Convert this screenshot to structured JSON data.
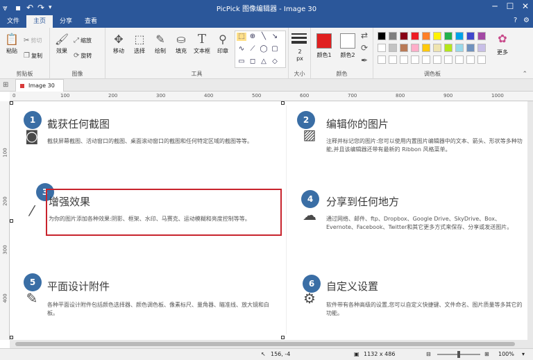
{
  "titlebar": {
    "title": "PicPick 图像编辑器 - Image 30"
  },
  "tabs": [
    "文件",
    "主页",
    "分享",
    "查看"
  ],
  "ribbon": {
    "clipboard": {
      "paste": "粘贴",
      "cut": "剪切",
      "copy": "复制",
      "label": "剪贴板"
    },
    "image": {
      "effects": "效果",
      "resize": "缩放",
      "rotate": "旋转",
      "label": "图像"
    },
    "tools": {
      "move": "移动",
      "select": "选择",
      "draw": "绘制",
      "fill": "填充",
      "textbox": "文本框",
      "stamp": "印章",
      "label": "工具"
    },
    "size": {
      "value": "2",
      "unit": "px",
      "label": "大小"
    },
    "color": {
      "color1": "颜色1",
      "color2": "颜色2",
      "label": "颜色",
      "color1_value": "#e02020",
      "color2_value": "#ffffff"
    },
    "palette": {
      "label": "调色板",
      "more": "更多",
      "row1": [
        "#000000",
        "#7f7f7f",
        "#880015",
        "#ed1c24",
        "#ff7f27",
        "#fff200",
        "#22b14c",
        "#00a2e8",
        "#3f48cc",
        "#a349a4"
      ],
      "row2": [
        "#ffffff",
        "#c3c3c3",
        "#b97a57",
        "#ffaec9",
        "#ffc90e",
        "#efe4b0",
        "#b5e61d",
        "#99d9ea",
        "#7092be",
        "#c8bfe7"
      ]
    }
  },
  "doc_tab": "Image 30",
  "ruler": {
    "h": [
      "0",
      "100",
      "200",
      "300",
      "400",
      "500",
      "600",
      "700",
      "800",
      "900",
      "1000"
    ],
    "v": [
      "100",
      "200",
      "300",
      "400"
    ]
  },
  "features": [
    {
      "num": "1",
      "title": "截获任何截图",
      "desc": "截获屏幕截图、活动窗口的截图、桌面滚动窗口的截图和任何特定区域的截图等等。",
      "icon": "camera-icon"
    },
    {
      "num": "2",
      "title": "编辑你的图片",
      "desc": "注释并标记您的图片:您可以使用内置图片编辑器中的文本、箭头、形状等多种功能,并且该编辑器还带有最新的 Ribbon 风格菜单。",
      "icon": "image-icon"
    },
    {
      "num": "3",
      "title": "增强效果",
      "desc": "为你的图片添加各种效果:阴影、框架、水印、马赛克、运动模糊和亮度控制等等。",
      "icon": "magic-wand-icon"
    },
    {
      "num": "4",
      "title": "分享到任何地方",
      "desc": "通过网络、邮件、ftp、Dropbox、Google Drive、SkyDrive、Box、Evernote、Facebook、Twitter和其它更多方式来保存、分享或发送图片。",
      "icon": "cloud-icon"
    },
    {
      "num": "5",
      "title": "平面设计附件",
      "desc": "各种平面设计附件包括颜色选择器、颜色调色板、像素标尺、量角器、瞄准线、放大镜和白板。",
      "icon": "pencil-icon"
    },
    {
      "num": "6",
      "title": "自定义设置",
      "desc": "软件带有各种高级的设置,您可以自定义快捷键、文件命名、图片质量等多其它的功能。",
      "icon": "gear-icon"
    }
  ],
  "status": {
    "cursor": "156, -4",
    "dimensions": "1132 x 486",
    "zoom": "100%"
  }
}
